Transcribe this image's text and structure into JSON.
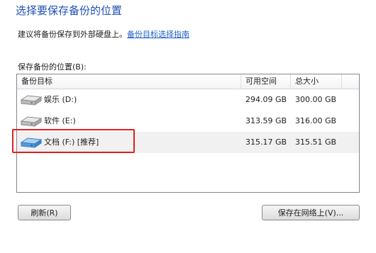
{
  "page": {
    "title": "选择要保存备份的位置",
    "advice_text": "建议将备份保存到外部硬盘上。",
    "advice_link": "备份目标选择指南",
    "list_label": "保存备份的位置(B):"
  },
  "table": {
    "columns": [
      "备份目标",
      "可用空间",
      "总大小"
    ],
    "rows": [
      {
        "icon": "hard-drive-icon",
        "name": "娱乐 (D:)",
        "free": "294.09 GB",
        "total": "300.00 GB",
        "selected": false
      },
      {
        "icon": "hard-drive-icon",
        "name": "软件 (E:)",
        "free": "313.59 GB",
        "total": "316.00 GB",
        "selected": false
      },
      {
        "icon": "hard-drive-icon",
        "name": "文档 (F:) [推荐]",
        "free": "315.17 GB",
        "total": "315.51 GB",
        "selected": true
      }
    ]
  },
  "buttons": {
    "refresh": "刷新(R)",
    "save_network": "保存在网络上(V)..."
  },
  "colors": {
    "title": "#1f4fb5",
    "link": "#1f5ec9",
    "highlight_box": "#e02020",
    "selected_drive_icon": "#4f9bd9"
  }
}
